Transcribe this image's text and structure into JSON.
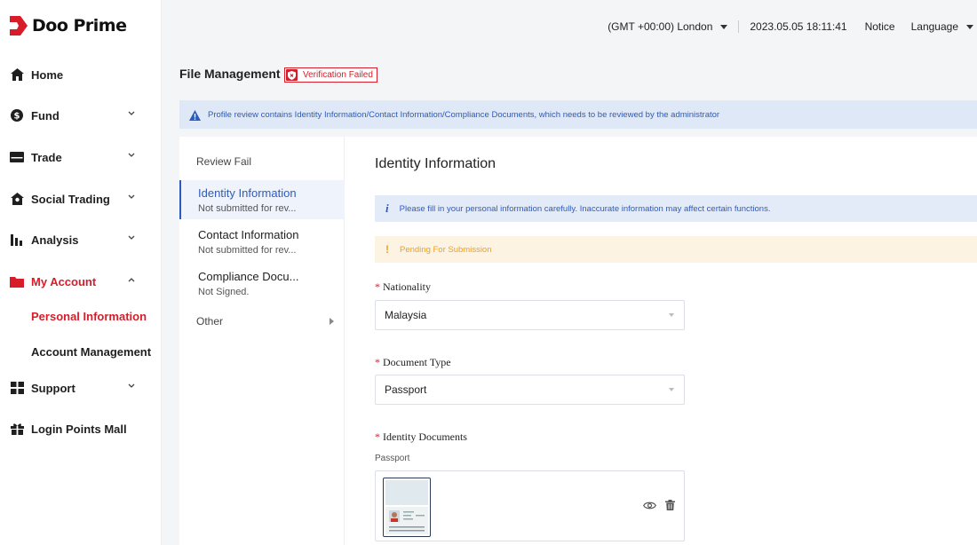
{
  "brand": {
    "name": "Doo Prime",
    "accent": "#d71d2a",
    "link": "#2d5bbd"
  },
  "sidebar": {
    "items": [
      {
        "label": "Home",
        "icon": "home-icon"
      },
      {
        "label": "Fund",
        "icon": "dollar-icon"
      },
      {
        "label": "Trade",
        "icon": "trade-icon"
      },
      {
        "label": "Social Trading",
        "icon": "social-icon"
      },
      {
        "label": "Analysis",
        "icon": "analysis-icon"
      },
      {
        "label": "My Account",
        "icon": "folder-icon"
      },
      {
        "label": "Support",
        "icon": "grid-icon"
      },
      {
        "label": "Login Points Mall",
        "icon": "gift-icon"
      }
    ],
    "sub_items": [
      {
        "label": "Personal Information"
      },
      {
        "label": "Account Management"
      }
    ]
  },
  "topbar": {
    "timezone": "(GMT +00:00) London",
    "datetime": "2023.05.05 18:11:41",
    "notice": "Notice",
    "language": "Language"
  },
  "page": {
    "title": "File Management",
    "status": "Verification Failed",
    "alert": "Profile review contains Identity Information/Contact Information/Compliance Documents, which needs to be reviewed by the administrator"
  },
  "steps": {
    "header": "Review Fail",
    "items": [
      {
        "title": "Identity Information",
        "sub": "Not submitted for rev..."
      },
      {
        "title": "Contact Information",
        "sub": "Not submitted for rev..."
      },
      {
        "title": "Compliance Docu...",
        "sub": "Not Signed."
      }
    ],
    "other": "Other"
  },
  "form": {
    "section_title": "Identity Information",
    "info": "Please fill in your personal information carefully. Inaccurate information may affect certain functions.",
    "info_icon": "i",
    "warning": "Pending For Submission",
    "warning_icon": "!",
    "required_mark": "*",
    "nationality_label": "Nationality",
    "nationality_value": "Malaysia",
    "doc_type_label": "Document Type",
    "doc_type_value": "Passport",
    "identity_docs_label": "Identity Documents",
    "identity_docs_sub": "Passport"
  }
}
